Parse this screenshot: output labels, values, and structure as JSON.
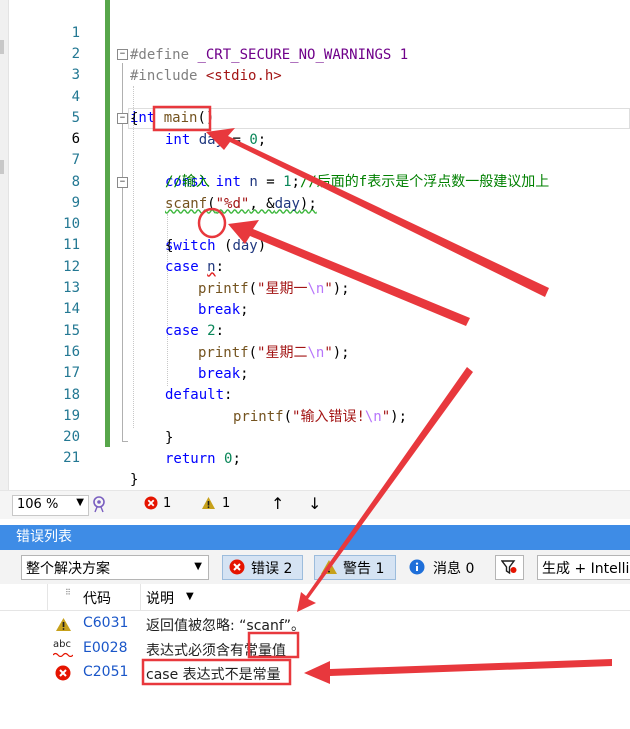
{
  "editor": {
    "lines": [
      {
        "n": "1"
      },
      {
        "n": "2"
      },
      {
        "n": "3"
      },
      {
        "n": "4"
      },
      {
        "n": "5"
      },
      {
        "n": "6"
      },
      {
        "n": "7"
      },
      {
        "n": "8"
      },
      {
        "n": "9"
      },
      {
        "n": "10"
      },
      {
        "n": "11"
      },
      {
        "n": "12"
      },
      {
        "n": "13"
      },
      {
        "n": "14"
      },
      {
        "n": "15"
      },
      {
        "n": "16"
      },
      {
        "n": "17"
      },
      {
        "n": "18"
      },
      {
        "n": "19"
      },
      {
        "n": "20"
      },
      {
        "n": "21"
      }
    ],
    "code": {
      "l1_define": "#define",
      "l1_macro": "_CRT_SECURE_NO_WARNINGS",
      "l1_val": "1",
      "l2_include": "#include",
      "l2_header": "<stdio.h>",
      "l3_int": "int",
      "l3_main": "main",
      "l3_paren": "()",
      "l4_brace": "{",
      "l5_int": "int",
      "l5_day": "day",
      "l5_eq": " = ",
      "l5_zero": "0",
      "l5_semi": ";",
      "l6_const": "const",
      "l6_int": "int",
      "l6_n": "n",
      "l6_eq": " = ",
      "l6_one": "1",
      "l6_semi": ";",
      "l6_comment": "//后面的f表示是个浮点数一般建议加上",
      "l7_comment": "//输入",
      "l8_scanf": "scanf",
      "l8_open": "(",
      "l8_fmt": "\"%d\"",
      "l8_mid": ", &",
      "l8_day": "day",
      "l8_close": ");",
      "l9_switch": "switch",
      "l9_open": " (",
      "l9_day": "day",
      "l9_close": ")",
      "l10_brace": "{",
      "l11_case": "case",
      "l11_n": "n",
      "l11_colon": ":",
      "l12_printf": "printf",
      "l12_open": "(",
      "l12_str": "\"星期一",
      "l12_esc": "\\n",
      "l12_q": "\"",
      "l12_close": ");",
      "l13_break": "break",
      "l13_semi": ";",
      "l14_case": "case",
      "l14_num": "2",
      "l14_colon": ":",
      "l15_printf": "printf",
      "l15_open": "(",
      "l15_str": "\"星期二",
      "l15_esc": "\\n",
      "l15_q": "\"",
      "l15_close": ");",
      "l16_break": "break",
      "l16_semi": ";",
      "l17_default": "default",
      "l17_colon": ":",
      "l18_printf": "printf",
      "l18_open": "(",
      "l18_str": "\"输入错误!",
      "l18_esc": "\\n",
      "l18_q": "\"",
      "l18_close": ");",
      "l19_brace": "}",
      "l20_return": "return",
      "l20_zero": "0",
      "l20_semi": ";",
      "l21_brace": "}",
      "fold_sign": "−"
    }
  },
  "status_bar": {
    "zoom": "106 %",
    "zoom_arrow": "▼",
    "error_count": "1",
    "warning_count": "1",
    "up_arrow": "↑",
    "down_arrow": "↓"
  },
  "error_list": {
    "title": "错误列表",
    "scope": "整个解决方案",
    "scope_arrow": "▼",
    "errors_button": "错误 2",
    "warnings_button": "警告 1",
    "messages_button": "消息 0",
    "build_filter": "生成 + IntelliSense",
    "col_code": "代码",
    "col_desc": "说明",
    "sort_arrow": "▼",
    "rows": [
      {
        "severity": "warning",
        "code": "C6031",
        "desc": "返回值被忽略: “scanf”。"
      },
      {
        "severity": "intellisense",
        "code": "E0028",
        "desc_a": "表达式必须含有",
        "desc_b": "常量值"
      },
      {
        "severity": "error",
        "code": "C2051",
        "desc": "case 表达式不是常量"
      }
    ],
    "abc_label": "abc"
  },
  "colors": {
    "keyword": "#0000ff",
    "comment": "#008000",
    "string": "#a31515",
    "annotation_red": "#e8383d",
    "error_list_header": "#3e8ce6",
    "change_bar": "#57a64a"
  }
}
